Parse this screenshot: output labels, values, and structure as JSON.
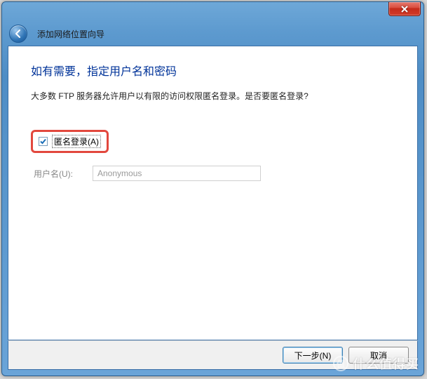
{
  "window": {
    "nav_title": "添加网络位置向导"
  },
  "page": {
    "heading": "如有需要，指定用户名和密码",
    "description": "大多数 FTP 服务器允许用户以有限的访问权限匿名登录。是否要匿名登录?"
  },
  "form": {
    "anon_checkbox_label": "匿名登录(A)",
    "anon_checkbox_checked": true,
    "username_label": "用户名(U):",
    "username_value": "Anonymous"
  },
  "buttons": {
    "next": "下一步(N)",
    "cancel": "取消"
  },
  "watermark": {
    "icon_text": "值",
    "text": "什么值得买"
  }
}
